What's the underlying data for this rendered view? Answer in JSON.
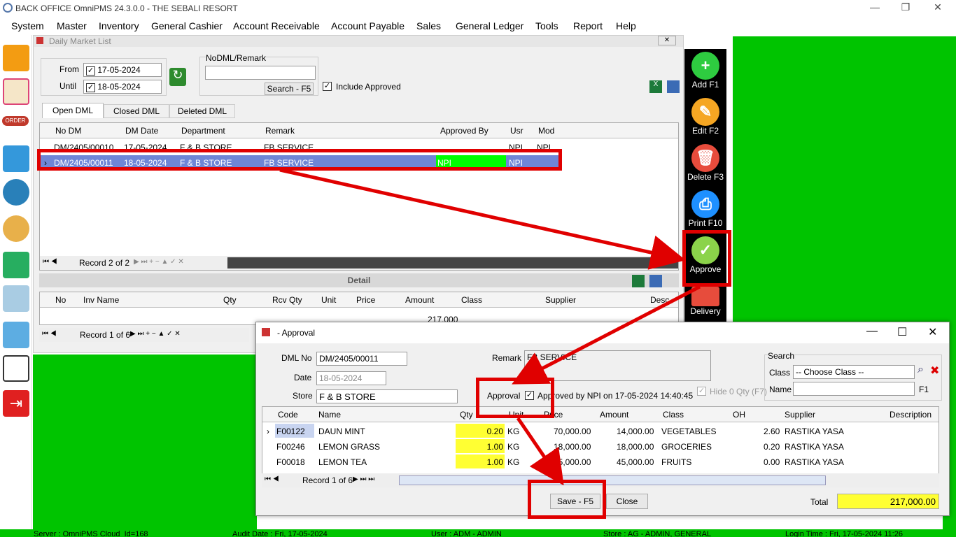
{
  "app": {
    "title": "BACK OFFICE OmniPMS 24.3.0.0 - THE SEBALI RESORT",
    "min": "—",
    "max": "❐",
    "close": "✕"
  },
  "menu": [
    "System",
    "Master",
    "Inventory",
    "General Cashier",
    "Account Receivable",
    "Account Payable",
    "Sales",
    "General Ledger",
    "Tools",
    "Report",
    "Help"
  ],
  "dml": {
    "title": "Daily Market List",
    "from_label": "From",
    "from_value": "17-05-2024",
    "until_label": "Until",
    "until_value": "18-05-2024",
    "nodml_label": "NoDML/Remark",
    "nodml_value": "",
    "search_btn": "Search - F5",
    "include_approved": "Include Approved",
    "tabs": [
      "Open DML",
      "Closed DML",
      "Deleted DML"
    ],
    "columns": [
      "No DM",
      "DM Date",
      "Department",
      "Remark",
      "Approved By",
      "Usr",
      "Mod"
    ],
    "rows": [
      [
        "DM/2405/00010",
        "17-05-2024",
        "F & B STORE",
        "FB SERVICE",
        "",
        "NPI",
        "NPI"
      ],
      [
        "DM/2405/00011",
        "18-05-2024",
        "F & B STORE",
        "FB SERVICE",
        "NPI",
        "NPI",
        ""
      ]
    ],
    "nav_record": "Record 2 of 2",
    "detail_title": "Detail",
    "detail_columns": [
      "No",
      "Inv Name",
      "Qty",
      "Rcv Qty",
      "Unit",
      "Price",
      "Amount",
      "Class",
      "Supplier",
      "Desc"
    ],
    "detail_total": "217,000",
    "detail_nav": "Record 1 of 6"
  },
  "toolbar": {
    "add": "Add F1",
    "edit": "Edit F2",
    "delete": "Delete F3",
    "print": "Print F10",
    "approve": "Approve",
    "delivery": "Delivery"
  },
  "approval": {
    "title": "- Approval",
    "dml_no_label": "DML No",
    "dml_no": "DM/2405/00011",
    "date_label": "Date",
    "date": "18-05-2024",
    "store_label": "Store",
    "store": "F & B STORE",
    "remark_label": "Remark",
    "remark": "FB SERVICE",
    "approval_label": "Approval",
    "approved_text": "Approved by NPI on 17-05-2024 14:40:45",
    "hide_zero": "Hide 0 Qty (F7)",
    "search_label": "Search",
    "class_label": "Class",
    "class_value": "-- Choose Class --",
    "name_label": "Name",
    "name_value": "",
    "f1": "F1",
    "columns": [
      "Code",
      "Name",
      "Qty",
      "Unit",
      "Price",
      "Amount",
      "Class",
      "OH",
      "Supplier",
      "Description"
    ],
    "rows": [
      [
        "F00122",
        "DAUN MINT",
        "0.20",
        "KG",
        "70,000.00",
        "14,000.00",
        "VEGETABLES",
        "2.60",
        "RASTIKA YASA",
        ""
      ],
      [
        "F00246",
        "LEMON GRASS",
        "1.00",
        "KG",
        "18,000.00",
        "18,000.00",
        "GROCERIES",
        "0.20",
        "RASTIKA YASA",
        ""
      ],
      [
        "F00018",
        "LEMON TEA",
        "1.00",
        "KG",
        "45,000.00",
        "45,000.00",
        "FRUITS",
        "0.00",
        "RASTIKA YASA",
        ""
      ]
    ],
    "nav_record": "Record 1 of 6",
    "save_btn": "Save - F5",
    "close_btn": "Close",
    "total_label": "Total",
    "total": "217,000.00"
  },
  "status": {
    "server": "Server : OmniPMS Cloud_Id=168",
    "audit": "Audit Date : Fri, 17-05-2024",
    "user": "User : ADM - ADMIN",
    "store": "Store : AG - ADMIN, GENERAL",
    "login": "Login Time : Fri, 17-05-2024 11:26"
  },
  "colors": {
    "green": "#00c400",
    "highlight_red": "#e00000",
    "selected_row": "#6f86d6",
    "approved_cell": "#00ff00",
    "qty_yellow": "#ffff33"
  }
}
